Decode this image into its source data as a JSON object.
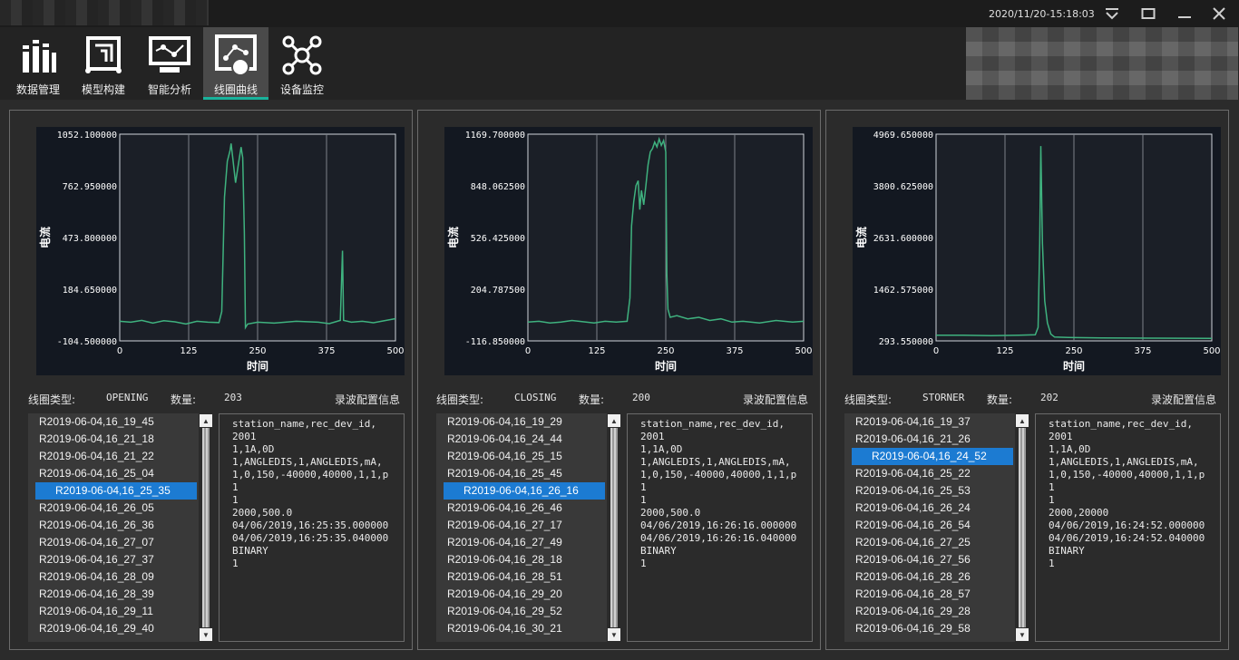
{
  "titlebar": {
    "datetime": "2020/11/20-15:18:03",
    "buttons": [
      "dropdown",
      "restore",
      "minimize",
      "close"
    ]
  },
  "toolbar": {
    "items": [
      {
        "label": "数据管理",
        "icon": "books-icon",
        "active": false
      },
      {
        "label": "模型构建",
        "icon": "model-build-icon",
        "active": false
      },
      {
        "label": "智能分析",
        "icon": "analysis-monitor-icon",
        "active": false
      },
      {
        "label": "线圈曲线",
        "icon": "coil-curve-icon",
        "active": true
      },
      {
        "label": "设备监控",
        "icon": "network-nodes-icon",
        "active": false
      }
    ],
    "active_color": "#19b39c"
  },
  "panels": [
    {
      "chart_data": {
        "type": "line",
        "xlabel": "时间",
        "ylabel": "电流",
        "xlim": [
          0,
          500
        ],
        "ylim": [
          -104.5,
          1052.1
        ],
        "x_ticks": [
          "0",
          "125",
          "250",
          "375",
          "500"
        ],
        "y_ticks": [
          "1052.100000",
          "762.950000",
          "473.800000",
          "184.650000",
          "-104.500000"
        ],
        "line_color": "#3fb27f",
        "series": [
          {
            "points": [
              [
                0,
                5
              ],
              [
                20,
                0
              ],
              [
                40,
                10
              ],
              [
                60,
                -5
              ],
              [
                80,
                8
              ],
              [
                100,
                2
              ],
              [
                120,
                -10
              ],
              [
                140,
                5
              ],
              [
                160,
                0
              ],
              [
                180,
                -2
              ],
              [
                185,
                60
              ],
              [
                190,
                700
              ],
              [
                195,
                900
              ],
              [
                200,
                960
              ],
              [
                202,
                1000
              ],
              [
                205,
                920
              ],
              [
                210,
                780
              ],
              [
                215,
                880
              ],
              [
                220,
                980
              ],
              [
                223,
                920
              ],
              [
                226,
                500
              ],
              [
                228,
                -30
              ],
              [
                232,
                -10
              ],
              [
                250,
                0
              ],
              [
                280,
                -5
              ],
              [
                320,
                5
              ],
              [
                360,
                0
              ],
              [
                380,
                -8
              ],
              [
                400,
                10
              ],
              [
                404,
                400
              ],
              [
                406,
                10
              ],
              [
                420,
                0
              ],
              [
                440,
                5
              ],
              [
                460,
                -3
              ],
              [
                480,
                8
              ],
              [
                500,
                20
              ]
            ]
          }
        ]
      },
      "info": {
        "type_label": "线圈类型:",
        "type_value": "OPENING",
        "count_label": "数量:",
        "count_value": "203",
        "config_label": "录波配置信息"
      },
      "list": {
        "items": [
          "R2019-06-04,16_19_45",
          "R2019-06-04,16_21_18",
          "R2019-06-04,16_21_22",
          "R2019-06-04,16_25_04",
          "R2019-06-04,16_25_35",
          "R2019-06-04,16_26_05",
          "R2019-06-04,16_26_36",
          "R2019-06-04,16_27_07",
          "R2019-06-04,16_27_37",
          "R2019-06-04,16_28_09",
          "R2019-06-04,16_28_39",
          "R2019-06-04,16_29_11",
          "R2019-06-04,16_29_40"
        ],
        "selected_index": 4
      },
      "config_lines": [
        "station_name,rec_dev_id,",
        "2001",
        "1,1A,0D",
        "1,ANGLEDIS,1,ANGLEDIS,mA,",
        "1,0,150,-40000,40000,1,1,p",
        "1",
        "1",
        "2000,500.0",
        "04/06/2019,16:25:35.000000",
        "04/06/2019,16:25:35.040000",
        "BINARY",
        "1"
      ]
    },
    {
      "chart_data": {
        "type": "line",
        "xlabel": "时间",
        "ylabel": "电流",
        "xlim": [
          0,
          500
        ],
        "ylim": [
          -116.85,
          1169.7
        ],
        "x_ticks": [
          "0",
          "125",
          "250",
          "375",
          "500"
        ],
        "y_ticks": [
          "1169.700000",
          "848.062500",
          "526.425000",
          "204.787500",
          "-116.850000"
        ],
        "line_color": "#3fb27f",
        "series": [
          {
            "points": [
              [
                0,
                0
              ],
              [
                20,
                5
              ],
              [
                40,
                -5
              ],
              [
                60,
                0
              ],
              [
                80,
                10
              ],
              [
                100,
                2
              ],
              [
                120,
                -5
              ],
              [
                140,
                5
              ],
              [
                160,
                0
              ],
              [
                180,
                5
              ],
              [
                185,
                150
              ],
              [
                188,
                600
              ],
              [
                192,
                750
              ],
              [
                196,
                850
              ],
              [
                200,
                880
              ],
              [
                203,
                700
              ],
              [
                206,
                820
              ],
              [
                210,
                730
              ],
              [
                214,
                850
              ],
              [
                218,
                980
              ],
              [
                222,
                1060
              ],
              [
                226,
                1080
              ],
              [
                230,
                1120
              ],
              [
                234,
                1090
              ],
              [
                238,
                1140
              ],
              [
                242,
                1100
              ],
              [
                246,
                1130
              ],
              [
                250,
                1060
              ],
              [
                252,
                300
              ],
              [
                254,
                80
              ],
              [
                258,
                30
              ],
              [
                270,
                40
              ],
              [
                290,
                20
              ],
              [
                310,
                30
              ],
              [
                330,
                10
              ],
              [
                350,
                20
              ],
              [
                370,
                0
              ],
              [
                390,
                5
              ],
              [
                420,
                -5
              ],
              [
                450,
                10
              ],
              [
                480,
                0
              ],
              [
                500,
                5
              ]
            ]
          }
        ]
      },
      "info": {
        "type_label": "线圈类型:",
        "type_value": "CLOSING",
        "count_label": "数量:",
        "count_value": "200",
        "config_label": "录波配置信息"
      },
      "list": {
        "items": [
          "R2019-06-04,16_19_29",
          "R2019-06-04,16_24_44",
          "R2019-06-04,16_25_15",
          "R2019-06-04,16_25_45",
          "R2019-06-04,16_26_16",
          "R2019-06-04,16_26_46",
          "R2019-06-04,16_27_17",
          "R2019-06-04,16_27_49",
          "R2019-06-04,16_28_18",
          "R2019-06-04,16_28_51",
          "R2019-06-04,16_29_20",
          "R2019-06-04,16_29_52",
          "R2019-06-04,16_30_21"
        ],
        "selected_index": 4
      },
      "config_lines": [
        "station_name,rec_dev_id,",
        "2001",
        "1,1A,0D",
        "1,ANGLEDIS,1,ANGLEDIS,mA,",
        "1,0,150,-40000,40000,1,1,p",
        "1",
        "1",
        "2000,500.0",
        "04/06/2019,16:26:16.000000",
        "04/06/2019,16:26:16.040000",
        "BINARY",
        "1"
      ]
    },
    {
      "chart_data": {
        "type": "line",
        "xlabel": "时间",
        "ylabel": "电流",
        "xlim": [
          0,
          500
        ],
        "ylim": [
          293.55,
          4969.65
        ],
        "x_ticks": [
          "0",
          "125",
          "250",
          "375",
          "500"
        ],
        "y_ticks": [
          "4969.650000",
          "3800.625000",
          "2631.600000",
          "1462.575000",
          "293.550000"
        ],
        "line_color": "#3fb27f",
        "series": [
          {
            "points": [
              [
                0,
                420
              ],
              [
                50,
                420
              ],
              [
                100,
                410
              ],
              [
                150,
                420
              ],
              [
                180,
                430
              ],
              [
                185,
                600
              ],
              [
                188,
                2500
              ],
              [
                190,
                4700
              ],
              [
                193,
                2500
              ],
              [
                197,
                1200
              ],
              [
                202,
                700
              ],
              [
                208,
                450
              ],
              [
                215,
                380
              ],
              [
                240,
                370
              ],
              [
                300,
                360
              ],
              [
                400,
                355
              ],
              [
                500,
                350
              ]
            ]
          }
        ]
      },
      "info": {
        "type_label": "线圈类型:",
        "type_value": "STORNER",
        "count_label": "数量:",
        "count_value": "202",
        "config_label": "录波配置信息"
      },
      "list": {
        "items": [
          "R2019-06-04,16_19_37",
          "R2019-06-04,16_21_26",
          "R2019-06-04,16_24_52",
          "R2019-06-04,16_25_22",
          "R2019-06-04,16_25_53",
          "R2019-06-04,16_26_24",
          "R2019-06-04,16_26_54",
          "R2019-06-04,16_27_25",
          "R2019-06-04,16_27_56",
          "R2019-06-04,16_28_26",
          "R2019-06-04,16_28_57",
          "R2019-06-04,16_29_28",
          "R2019-06-04,16_29_58"
        ],
        "selected_index": 2
      },
      "config_lines": [
        "station_name,rec_dev_id,",
        "2001",
        "1,1A,0D",
        "1,ANGLEDIS,1,ANGLEDIS,mA,",
        "1,0,150,-40000,40000,1,1,p",
        "1",
        "1",
        "2000,20000",
        "04/06/2019,16:24:52.000000",
        "04/06/2019,16:24:52.040000",
        "BINARY",
        "1"
      ]
    }
  ]
}
